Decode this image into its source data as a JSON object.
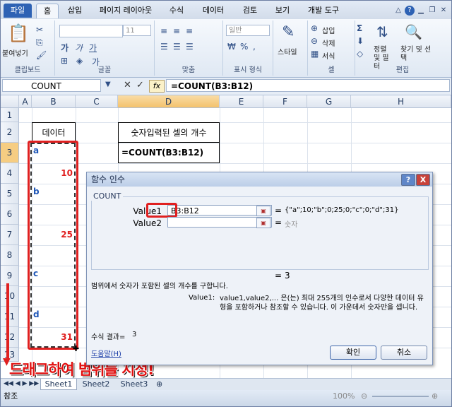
{
  "ribbon_tabs": [
    "파일",
    "홈",
    "삽입",
    "페이지 레이아웃",
    "수식",
    "데이터",
    "검토",
    "보기",
    "개발 도구"
  ],
  "ribbon": {
    "paste_label": "붙여넣기",
    "clipboard_group": "클립보드",
    "font_group": "글꼴",
    "font_size": "11",
    "align_group": "맞춤",
    "number_format": "일반",
    "number_group": "표시 형식",
    "style_label": "스타일",
    "insert_label": "삽입",
    "delete_label": "삭제",
    "format_label": "서식",
    "cells_group": "셀",
    "sort_filter_label": "정렬 및 필터",
    "find_select_label": "찾기 및 선택",
    "editing_group": "편집"
  },
  "formula_bar": {
    "name_box": "COUNT",
    "fx": "fx",
    "formula": "=COUNT(B3:B12)"
  },
  "columns": [
    "A",
    "B",
    "C",
    "D",
    "E",
    "F",
    "G",
    "H"
  ],
  "rows": [
    "1",
    "2",
    "3",
    "4",
    "5",
    "6",
    "7",
    "8",
    "9",
    "10",
    "11",
    "12",
    "13"
  ],
  "cells": {
    "b2": "데이터",
    "d2": "숫자입력된 셀의 개수",
    "d3": "=COUNT(B3:B12)",
    "b3": "a",
    "b4": "10",
    "b5": "b",
    "b7": "25",
    "b9": "c",
    "b11": "d",
    "b12": "31"
  },
  "dialog": {
    "title": "함수 인수",
    "function_name": "COUNT",
    "value1_label": "Value1",
    "value1_input": "B3:B12",
    "value1_result": "{\"a\";10;\"b\";0;25;0;\"c\";0;\"d\";31}",
    "value2_label": "Value2",
    "value2_result": "숫자",
    "equals": "=",
    "formula_result_line": "3",
    "description": "범위에서 숫자가 포함된 셀의 개수를 구합니다.",
    "arg_desc_label": "Value1:",
    "arg_desc": "value1,value2,... 은(는) 최대 255개의 인수로서 다양한 데이터 유형을 포함하거나 참조할 수 있습니다. 이 가운데서 숫자만을 셉니다.",
    "result_label": "수식 결과=",
    "result_value": "3",
    "help_link": "도움말(H)",
    "ok_label": "확인",
    "cancel_label": "취소",
    "help_btn": "?",
    "close_btn": "X"
  },
  "annotation": "드래그하여 범위를 지정!",
  "sheet_tabs": [
    "Sheet1",
    "Sheet2",
    "Sheet3"
  ],
  "status": {
    "mode": "참조",
    "zoom": "100%"
  }
}
